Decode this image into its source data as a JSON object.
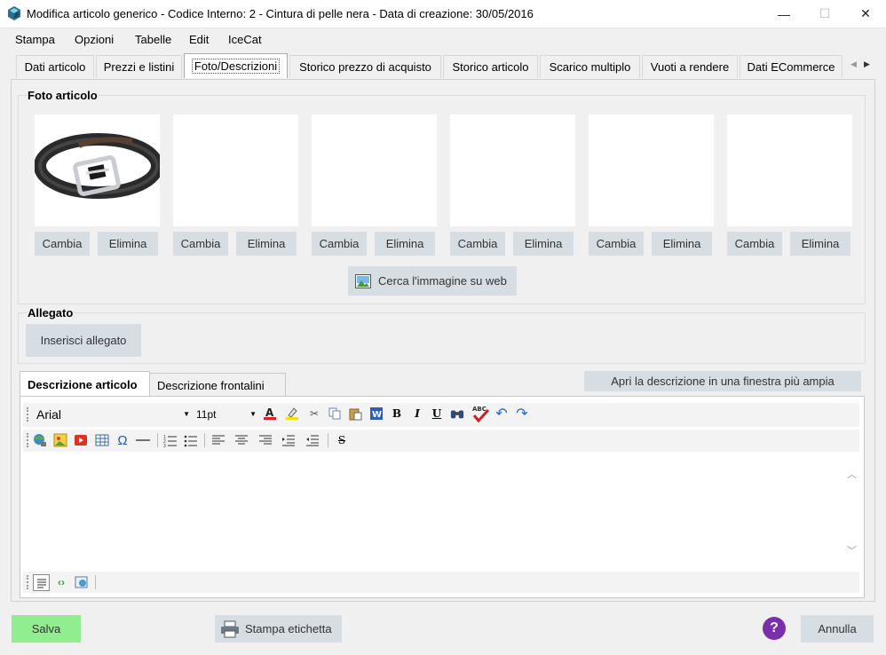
{
  "window": {
    "title": "Modifica articolo generico - Codice Interno: 2 - Cintura di pelle nera - Data di creazione: 30/05/2016",
    "minimize": "—",
    "maximize": "☐",
    "close": "✕"
  },
  "menu": [
    "Stampa",
    "Opzioni",
    "Tabelle",
    "Edit",
    "IceCat"
  ],
  "tabs": [
    "Dati articolo",
    "Prezzi e listini",
    "Foto/Descrizioni",
    "Storico prezzo di acquisto",
    "Storico articolo",
    "Scarico multiplo",
    "Vuoti a rendere",
    "Dati ECommerce"
  ],
  "tab_nav": {
    "prev": "◀",
    "next": "▶"
  },
  "photos": {
    "title": "Foto articolo",
    "change_label": "Cambia",
    "delete_label": "Elimina",
    "search_web_label": "Cerca l'immagine su web"
  },
  "attachment": {
    "title": "Allegato",
    "insert_label": "Inserisci allegato"
  },
  "editor": {
    "tabs": [
      "Descrizione articolo",
      "Descrizione frontalini"
    ],
    "open_wide_label": "Apri la descrizione in una finestra più ampia",
    "font_value": "Arial",
    "size_value": "11pt",
    "bold": "B",
    "italic": "I",
    "underline": "U",
    "spell": "ABC",
    "special_char": "Ω",
    "strike": "S"
  },
  "footer": {
    "save_label": "Salva",
    "print_label": "Stampa etichetta",
    "help": "?",
    "cancel_label": "Annulla"
  },
  "colors": {
    "save_bg": "#90ee90",
    "button_bg": "#d6dde3",
    "help": "#7b2fa8"
  }
}
